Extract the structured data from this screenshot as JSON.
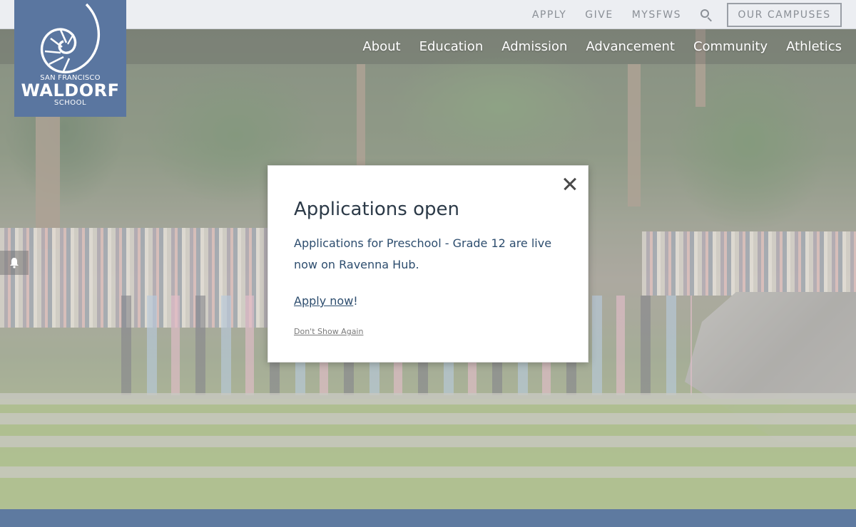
{
  "utility_nav": {
    "links": [
      "APPLY",
      "GIVE",
      "MYSFWS"
    ],
    "campuses_button": "OUR CAMPUSES"
  },
  "main_nav": {
    "items": [
      "About",
      "Education",
      "Admission",
      "Advancement",
      "Community",
      "Athletics"
    ]
  },
  "logo": {
    "line1": "SAN FRANCISCO",
    "line2": "WALDORF",
    "line3": "SCHOOL"
  },
  "modal": {
    "title": "Applications open",
    "body": "Applications for Preschool - Grade 12 are live now on Ravenna Hub.",
    "apply_link": "Apply now",
    "apply_suffix": "!",
    "dismiss": "Don't Show Again"
  },
  "colors": {
    "brand_blue": "#5a76a0",
    "modal_text": "#2d4d6e"
  }
}
